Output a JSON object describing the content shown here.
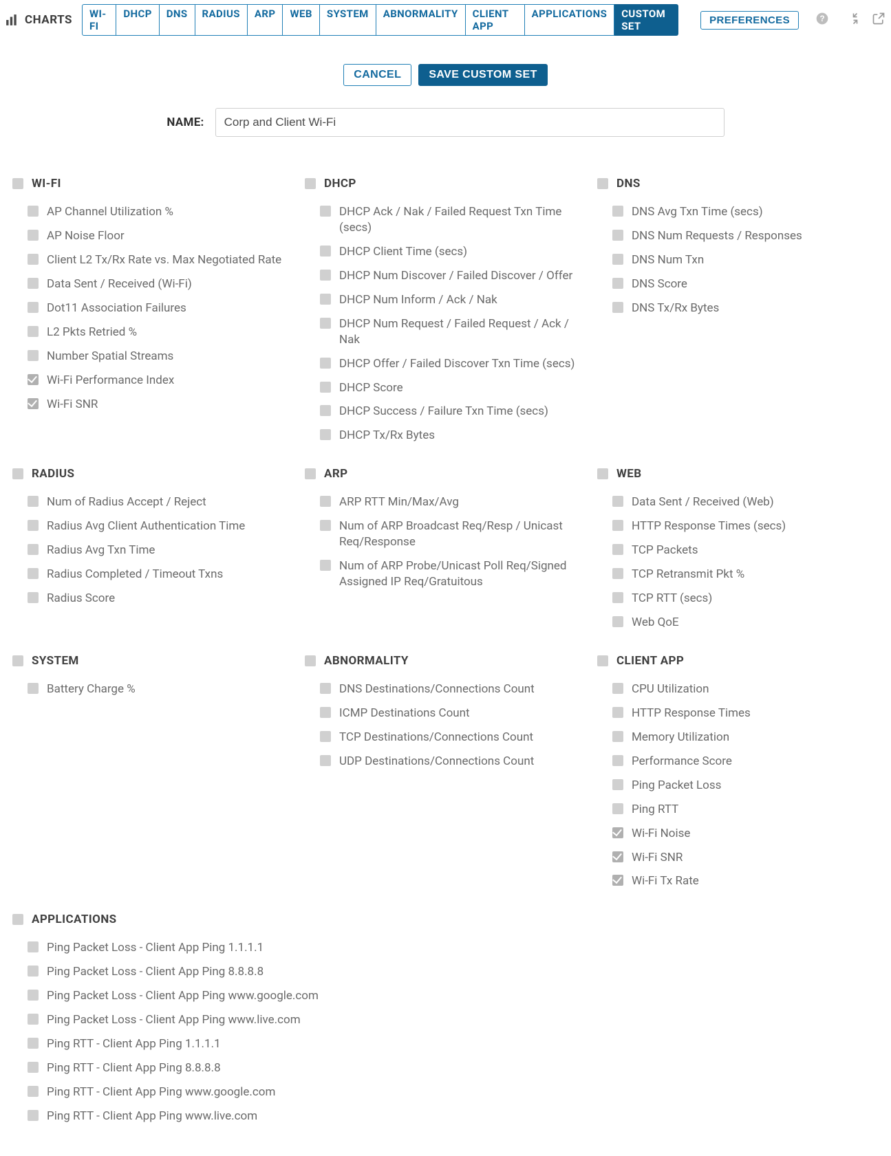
{
  "header": {
    "charts_label": "CHARTS",
    "tabs": [
      "WI-FI",
      "DHCP",
      "DNS",
      "RADIUS",
      "ARP",
      "WEB",
      "SYSTEM",
      "ABNORMALITY",
      "CLIENT APP",
      "APPLICATIONS",
      "CUSTOM SET"
    ],
    "active_tab_index": 10,
    "preferences_label": "PREFERENCES"
  },
  "actions": {
    "cancel_label": "CANCEL",
    "save_label": "SAVE CUSTOM SET"
  },
  "name": {
    "label": "NAME:",
    "value": "Corp and Client Wi-Fi"
  },
  "sections": [
    {
      "title": "WI-FI",
      "items": [
        {
          "label": "AP Channel Utilization %",
          "checked": false
        },
        {
          "label": "AP Noise Floor",
          "checked": false
        },
        {
          "label": "Client L2 Tx/Rx Rate vs. Max Negotiated Rate",
          "checked": false
        },
        {
          "label": "Data Sent / Received (Wi-Fi)",
          "checked": false
        },
        {
          "label": "Dot11 Association Failures",
          "checked": false
        },
        {
          "label": "L2 Pkts Retried %",
          "checked": false
        },
        {
          "label": "Number Spatial Streams",
          "checked": false
        },
        {
          "label": "Wi-Fi Performance Index",
          "checked": true
        },
        {
          "label": "Wi-Fi SNR",
          "checked": true
        }
      ]
    },
    {
      "title": "DHCP",
      "items": [
        {
          "label": "DHCP Ack / Nak / Failed Request Txn Time (secs)",
          "checked": false
        },
        {
          "label": "DHCP Client Time (secs)",
          "checked": false
        },
        {
          "label": "DHCP Num Discover / Failed Discover / Offer",
          "checked": false
        },
        {
          "label": "DHCP Num Inform / Ack / Nak",
          "checked": false
        },
        {
          "label": "DHCP Num Request / Failed Request / Ack / Nak",
          "checked": false
        },
        {
          "label": "DHCP Offer / Failed Discover Txn Time (secs)",
          "checked": false
        },
        {
          "label": "DHCP Score",
          "checked": false
        },
        {
          "label": "DHCP Success / Failure Txn Time (secs)",
          "checked": false
        },
        {
          "label": "DHCP Tx/Rx Bytes",
          "checked": false
        }
      ]
    },
    {
      "title": "DNS",
      "items": [
        {
          "label": "DNS Avg Txn Time (secs)",
          "checked": false
        },
        {
          "label": "DNS Num Requests / Responses",
          "checked": false
        },
        {
          "label": "DNS Num Txn",
          "checked": false
        },
        {
          "label": "DNS Score",
          "checked": false
        },
        {
          "label": "DNS Tx/Rx Bytes",
          "checked": false
        }
      ]
    },
    {
      "title": "RADIUS",
      "items": [
        {
          "label": "Num of Radius Accept / Reject",
          "checked": false
        },
        {
          "label": "Radius Avg Client Authentication Time",
          "checked": false
        },
        {
          "label": "Radius Avg Txn Time",
          "checked": false
        },
        {
          "label": "Radius Completed / Timeout Txns",
          "checked": false
        },
        {
          "label": "Radius Score",
          "checked": false
        }
      ]
    },
    {
      "title": "ARP",
      "items": [
        {
          "label": "ARP RTT Min/Max/Avg",
          "checked": false
        },
        {
          "label": "Num of ARP Broadcast Req/Resp / Unicast Req/Response",
          "checked": false
        },
        {
          "label": "Num of ARP Probe/Unicast Poll Req/Signed Assigned IP Req/Gratuitous",
          "checked": false
        }
      ]
    },
    {
      "title": "WEB",
      "items": [
        {
          "label": "Data Sent / Received (Web)",
          "checked": false
        },
        {
          "label": "HTTP Response Times (secs)",
          "checked": false
        },
        {
          "label": "TCP Packets",
          "checked": false
        },
        {
          "label": "TCP Retransmit Pkt %",
          "checked": false
        },
        {
          "label": "TCP RTT (secs)",
          "checked": false
        },
        {
          "label": "Web QoE",
          "checked": false
        }
      ]
    },
    {
      "title": "SYSTEM",
      "items": [
        {
          "label": "Battery Charge %",
          "checked": false
        }
      ]
    },
    {
      "title": "ABNORMALITY",
      "items": [
        {
          "label": "DNS Destinations/Connections Count",
          "checked": false
        },
        {
          "label": "ICMP Destinations Count",
          "checked": false
        },
        {
          "label": "TCP Destinations/Connections Count",
          "checked": false
        },
        {
          "label": "UDP Destinations/Connections Count",
          "checked": false
        }
      ]
    },
    {
      "title": "CLIENT APP",
      "items": [
        {
          "label": "CPU Utilization",
          "checked": false
        },
        {
          "label": "HTTP Response Times",
          "checked": false
        },
        {
          "label": "Memory Utilization",
          "checked": false
        },
        {
          "label": "Performance Score",
          "checked": false
        },
        {
          "label": "Ping Packet Loss",
          "checked": false
        },
        {
          "label": "Ping RTT",
          "checked": false
        },
        {
          "label": "Wi-Fi Noise",
          "checked": true
        },
        {
          "label": "Wi-Fi SNR",
          "checked": true
        },
        {
          "label": "Wi-Fi Tx Rate",
          "checked": true
        }
      ]
    },
    {
      "title": "APPLICATIONS",
      "full_width": true,
      "items": [
        {
          "label": "Ping Packet Loss - Client App Ping 1.1.1.1",
          "checked": false
        },
        {
          "label": "Ping Packet Loss - Client App Ping 8.8.8.8",
          "checked": false
        },
        {
          "label": "Ping Packet Loss - Client App Ping www.google.com",
          "checked": false
        },
        {
          "label": "Ping Packet Loss - Client App Ping www.live.com",
          "checked": false
        },
        {
          "label": "Ping RTT - Client App Ping 1.1.1.1",
          "checked": false
        },
        {
          "label": "Ping RTT - Client App Ping 8.8.8.8",
          "checked": false
        },
        {
          "label": "Ping RTT - Client App Ping www.google.com",
          "checked": false
        },
        {
          "label": "Ping RTT - Client App Ping www.live.com",
          "checked": false
        }
      ]
    }
  ]
}
